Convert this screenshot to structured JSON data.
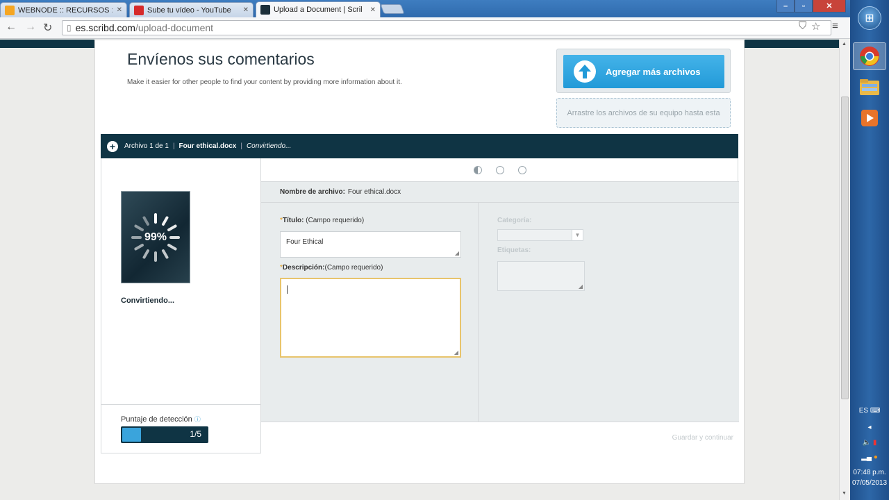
{
  "browser": {
    "tabs": [
      {
        "label": "WEBNODE :: RECURSOS ::",
        "active": false,
        "favicon_color": "#f5a623"
      },
      {
        "label": "Sube tu vídeo - YouTube",
        "active": false,
        "favicon_color": "#d62a2a"
      },
      {
        "label": "Upload a Document | Scril",
        "active": true,
        "favicon_color": "#1c2f3a"
      }
    ],
    "url_domain": "es.scribd.com",
    "url_path": "/upload-document"
  },
  "page": {
    "title": "Envíenos sus comentarios",
    "subtitle": "Make it easier for other people to find your content by providing more information about it.",
    "add_files_button": "Agregar más archivos",
    "dropzone_text": "Arrastre los archivos de su equipo hasta esta",
    "file_bar": {
      "count": "Archivo 1 de 1",
      "file_name": "Four ethical.docx",
      "status": "Convirtiendo..."
    },
    "progress_percent": "99%",
    "thumb_status": "Convirtiendo...",
    "score": {
      "label": "Puntaje de detección",
      "info_icon": "ⓘ",
      "value_text": "1/5",
      "fraction": 0.2
    },
    "filename_label": "Nombre de archivo:",
    "filename_value": "Four ethical.docx",
    "form": {
      "title_label": "Título:",
      "title_req": "(Campo requerido)",
      "title_value": "Four Ethical",
      "desc_label": "Descripción:",
      "desc_req": "(Campo requerido)",
      "desc_value": "",
      "category_label": "Categoría:",
      "tags_label": "Etiquetas:"
    },
    "save_button": "Guardar y continuar"
  },
  "system": {
    "language": "ES",
    "time": "07:48 p.m.",
    "date": "07/05/2013"
  },
  "colors": {
    "dark_navy": "#0f3444",
    "accent_blue": "#229ad8",
    "focus_border": "#e8c46c"
  }
}
